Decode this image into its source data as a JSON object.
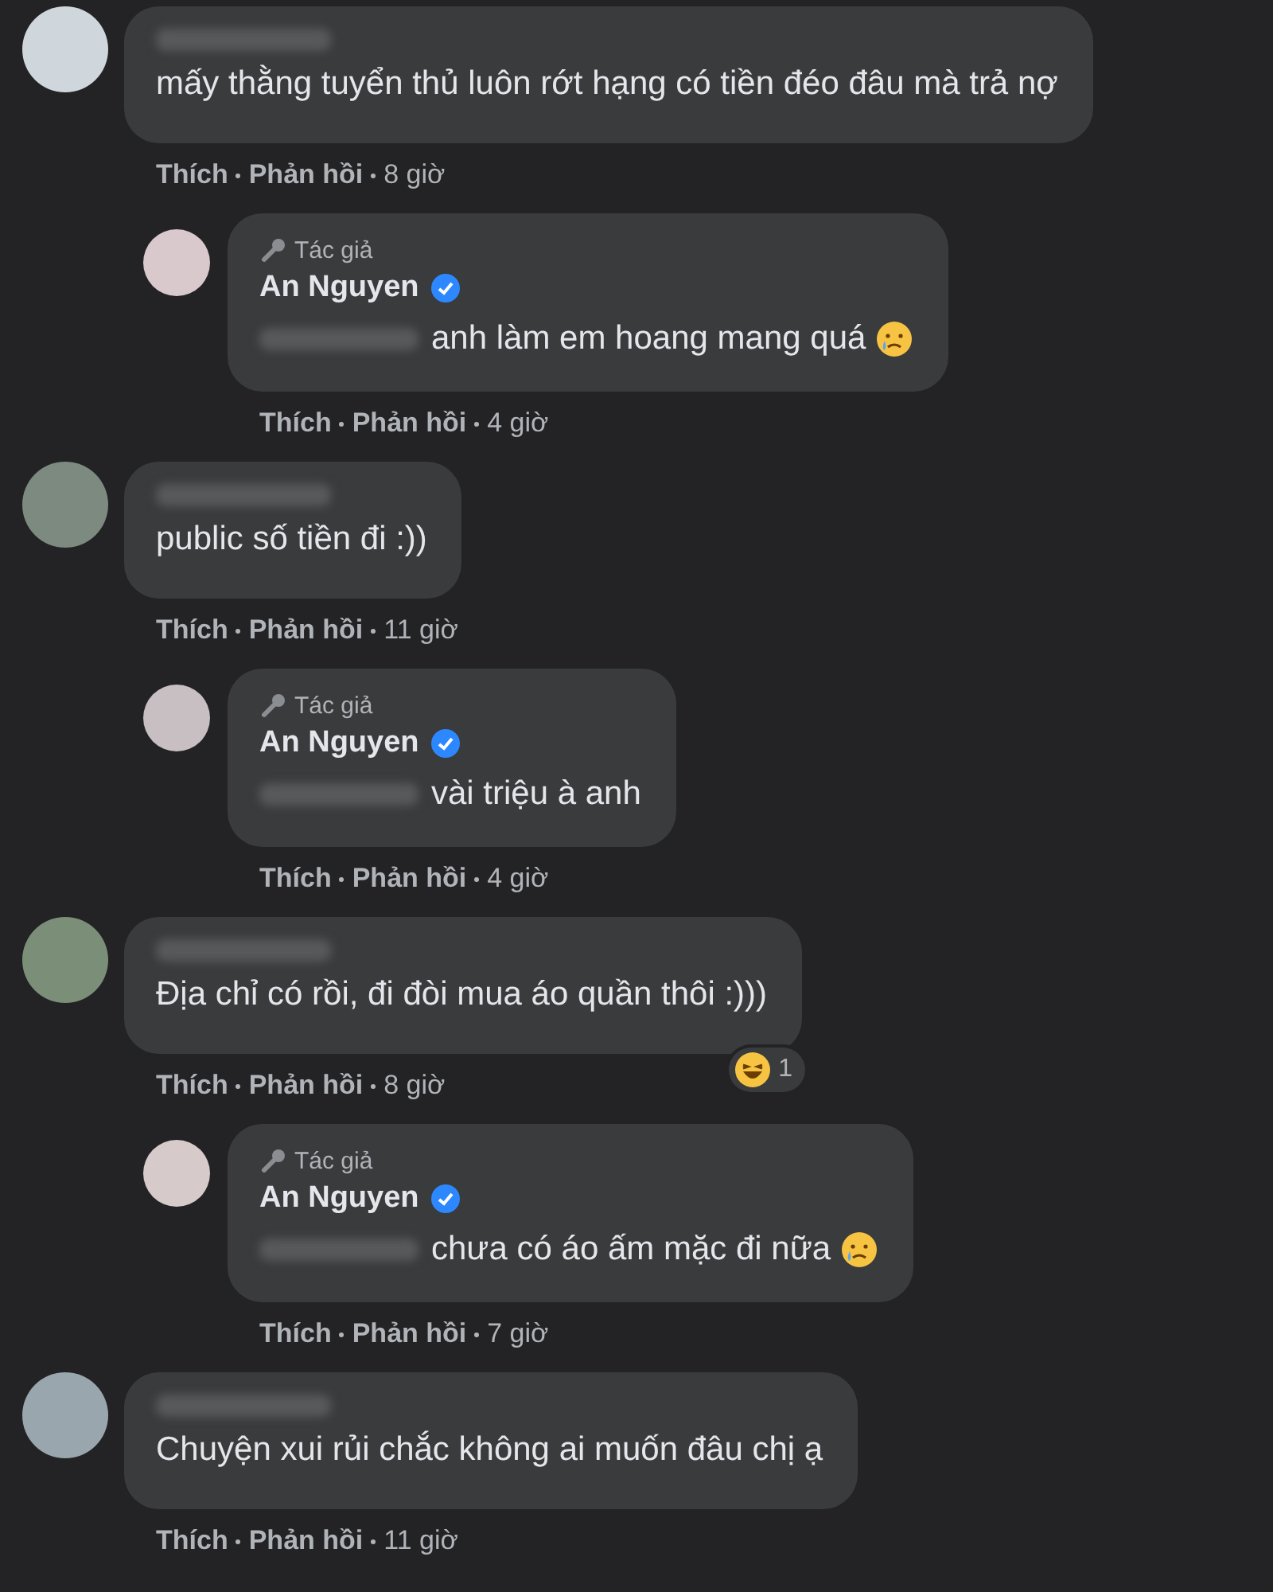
{
  "comments": [
    {
      "kind": "comment",
      "text": "mấy thằng tuyển thủ luôn rớt hạng có tiền đéo đâu mà trả nợ",
      "emoji": false,
      "actions": [
        "Thích",
        "Phản hồi",
        "8 giờ"
      ]
    },
    {
      "kind": "reply",
      "badge": "Tác giả",
      "author": "An Nguyen",
      "verified": true,
      "text": "anh làm em hoang mang quá",
      "emoji": true,
      "actions": [
        "Thích",
        "Phản hồi",
        "4 giờ"
      ]
    },
    {
      "kind": "comment",
      "text": "public số tiền đi :))",
      "emoji": false,
      "actions": [
        "Thích",
        "Phản hồi",
        "11 giờ"
      ]
    },
    {
      "kind": "reply",
      "badge": "Tác giả",
      "author": "An Nguyen",
      "verified": true,
      "text": "vài triệu à anh",
      "emoji": false,
      "actions": [
        "Thích",
        "Phản hồi",
        "4 giờ"
      ]
    },
    {
      "kind": "comment",
      "text": "Địa chỉ có rồi, đi đòi mua áo quần thôi :)))",
      "emoji": false,
      "reaction": {
        "count": "1"
      },
      "actions": [
        "Thích",
        "Phản hồi",
        "8 giờ"
      ]
    },
    {
      "kind": "reply",
      "badge": "Tác giả",
      "author": "An Nguyen",
      "verified": true,
      "text": "chưa có áo ấm mặc đi nữa",
      "emoji": true,
      "actions": [
        "Thích",
        "Phản hồi",
        "7 giờ"
      ]
    },
    {
      "kind": "comment",
      "text": "Chuyện xui rủi chắc không ai muốn đâu chị ạ",
      "emoji": false,
      "actions": [
        "Thích",
        "Phản hồi",
        "11 giờ"
      ]
    }
  ]
}
